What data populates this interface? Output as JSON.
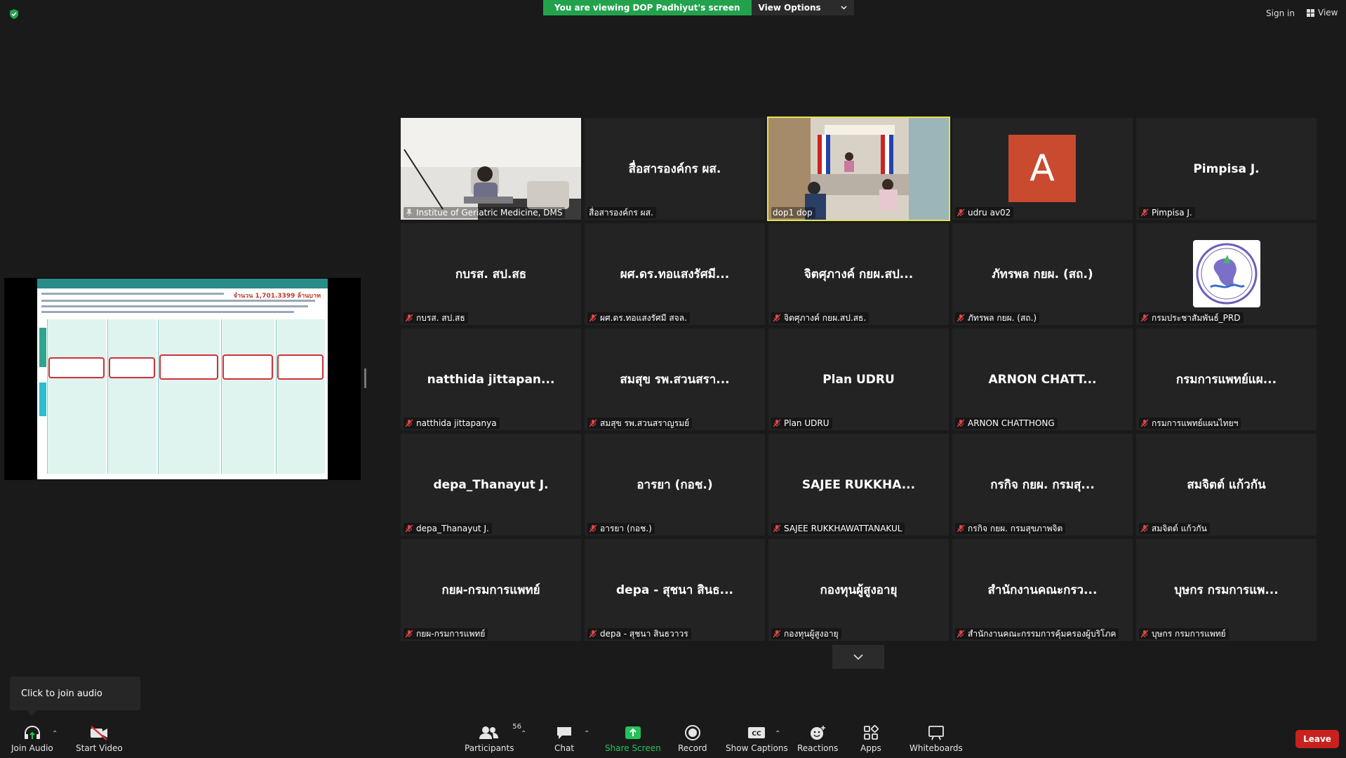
{
  "banner": {
    "viewing_text": "You are viewing DOP Padhiyut's screen",
    "view_options_label": "View Options"
  },
  "top_right": {
    "sign_in_label": "Sign in",
    "view_label": "View"
  },
  "shared_slide": {
    "amount_label": "จำนวน 1,701.3399 ล้านบาท"
  },
  "tiles": [
    {
      "display": "",
      "label": "Institue of Geriatric Medicine, DMS",
      "muted": false,
      "pinned": true,
      "type": "video-woman"
    },
    {
      "display": "สื่อสารองค์กร ผส.",
      "label": "สื่อสารองค์กร ผส.",
      "muted": false,
      "type": "name"
    },
    {
      "display": "",
      "label": "dop1 dop",
      "muted": false,
      "active": true,
      "type": "video-room"
    },
    {
      "display": "A",
      "label": "udru av02",
      "muted": true,
      "type": "avatar"
    },
    {
      "display": "Pimpisa J.",
      "label": "Pimpisa J.",
      "muted": true,
      "type": "name"
    },
    {
      "display": "กบรส. สป.สธ",
      "label": "กบรส. สป.สธ",
      "muted": true,
      "type": "name"
    },
    {
      "display": "ผศ.ดร.ทอแสงรัศมี...",
      "label": "ผศ.ดร.ทอแสงรัศมี สจล.",
      "muted": true,
      "type": "name"
    },
    {
      "display": "จิตศุภางค์ กยผ.สป...",
      "label": "จิตศุภางค์ กยผ.สป.สธ.",
      "muted": true,
      "type": "name"
    },
    {
      "display": "ภัทรพล กยผ. (สถ.)",
      "label": "ภัทรพล กยผ. (สถ.)",
      "muted": true,
      "type": "name"
    },
    {
      "display": "",
      "label": "กรมประชาสัมพันธ์_PRD",
      "muted": true,
      "type": "logo"
    },
    {
      "display": "natthida  jittapan...",
      "label": "natthida jittapanya",
      "muted": true,
      "type": "name"
    },
    {
      "display": "สมสุข รพ.สวนสรา...",
      "label": "สมสุข รพ.สวนสราญรมย์",
      "muted": true,
      "type": "name"
    },
    {
      "display": "Plan UDRU",
      "label": "Plan UDRU",
      "muted": true,
      "type": "name"
    },
    {
      "display": "ARNON  CHATT...",
      "label": "ARNON CHATTHONG",
      "muted": true,
      "type": "name"
    },
    {
      "display": "กรมการแพทย์แผ...",
      "label": "กรมการแพทย์แผนไทยฯ",
      "muted": true,
      "type": "name"
    },
    {
      "display": "depa_Thanayut J.",
      "label": "depa_Thanayut J.",
      "muted": true,
      "type": "name"
    },
    {
      "display": "อารยา (กอช.)",
      "label": "อารยา (กอช.)",
      "muted": true,
      "type": "name"
    },
    {
      "display": "SAJEE  RUKKHA...",
      "label": "SAJEE RUKKHAWATTANAKUL",
      "muted": true,
      "type": "name"
    },
    {
      "display": "กรกิจ กยผ. กรมสุ...",
      "label": "กรกิจ กยผ. กรมสุขภาพจิต",
      "muted": true,
      "type": "name"
    },
    {
      "display": "สมจิตต์ แก้วกัน",
      "label": "สมจิตต์ แก้วกัน",
      "muted": true,
      "type": "name"
    },
    {
      "display": "กยผ-กรมการแพทย์",
      "label": "กยผ-กรมการแพทย์",
      "muted": true,
      "type": "name"
    },
    {
      "display": "depa - สุชนา สินธ...",
      "label": "depa - สุชนา สินธวาวร",
      "muted": true,
      "type": "name"
    },
    {
      "display": "กองทุนผู้สูงอายุ",
      "label": "กองทุนผู้สูงอายุ",
      "muted": true,
      "type": "name"
    },
    {
      "display": "สำนักงานคณะกรว...",
      "label": "สำนักงานคณะกรรมการคุ้มครองผู้บริโภค",
      "muted": true,
      "type": "name"
    },
    {
      "display": "บุษกร กรมการแพ...",
      "label": "บุษกร กรมการแพทย์",
      "muted": true,
      "type": "name"
    }
  ],
  "tooltip": {
    "text": "Click to join audio"
  },
  "toolbar": {
    "join_audio": "Join Audio",
    "start_video": "Start Video",
    "participants": "Participants",
    "participants_count": "56",
    "chat": "Chat",
    "share_screen": "Share Screen",
    "record": "Record",
    "show_captions": "Show Captions",
    "reactions": "Reactions",
    "apps": "Apps",
    "whiteboards": "Whiteboards",
    "leave": "Leave"
  },
  "colors": {
    "banner_green": "#23a24d",
    "active_speaker": "#e2e24a",
    "leave_red": "#c9211e",
    "share_green": "#23c35a"
  }
}
